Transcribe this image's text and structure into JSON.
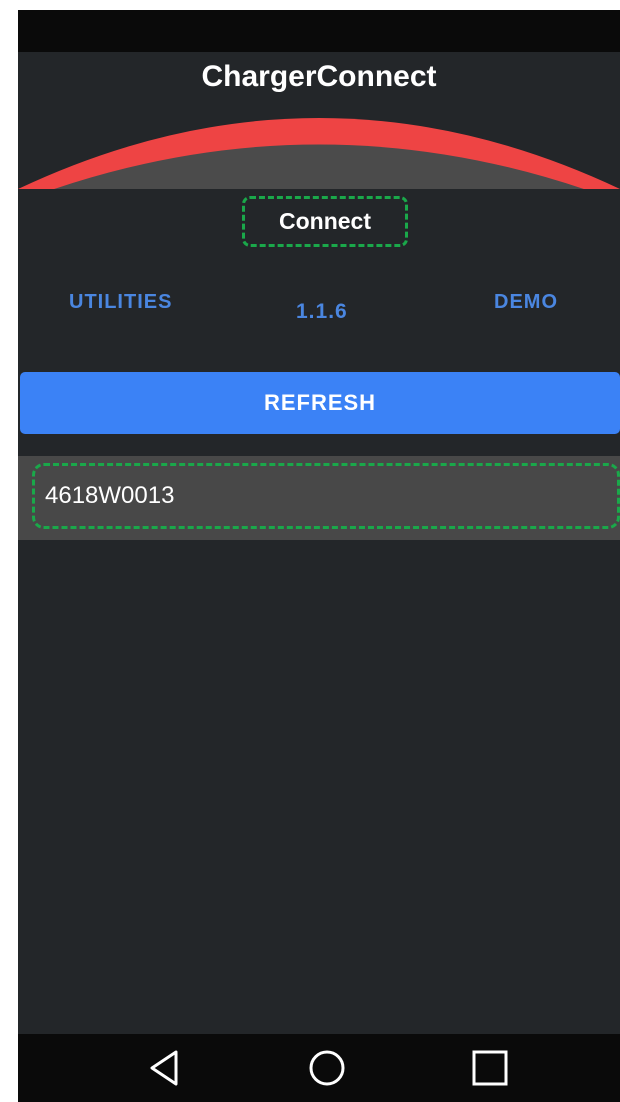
{
  "app": {
    "title": "ChargerConnect"
  },
  "header": {
    "accent_color": "#ee4444"
  },
  "connect": {
    "label": "Connect"
  },
  "nav": {
    "utilities_label": "UTILITIES",
    "version_label": "1.1.6",
    "demo_label": "DEMO"
  },
  "refresh": {
    "label": "REFRESH"
  },
  "devices": {
    "items": [
      {
        "label": "4618W0013"
      }
    ]
  },
  "system_nav": {
    "back_icon": "back-triangle-icon",
    "home_icon": "home-circle-icon",
    "recents_icon": "recents-square-icon"
  }
}
